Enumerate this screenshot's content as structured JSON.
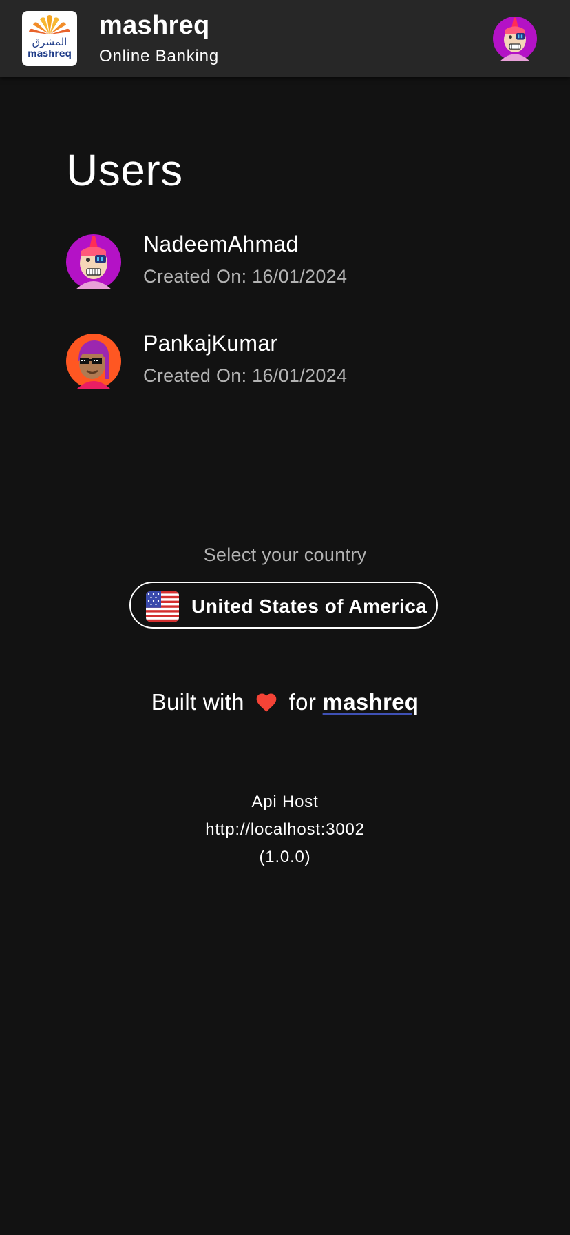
{
  "header": {
    "title": "mashreq",
    "subtitle": "Online Banking",
    "logo_arabic": "المشرق",
    "logo_latin": "mashreq",
    "logo_icon": "mashreq-sun-logo-icon",
    "avatar_icon": "user-avatar-icon"
  },
  "users": {
    "title": "Users",
    "items": [
      {
        "name": "NadeemAhmad",
        "created": "Created On: 16/01/2024",
        "avatar": "avatar-mohawk-icon"
      },
      {
        "name": "PankajKumar",
        "created": "Created On: 16/01/2024",
        "avatar": "avatar-sunglasses-icon"
      }
    ]
  },
  "country": {
    "label": "Select your country",
    "selected": "United States of America",
    "flag_icon": "us-flag-icon"
  },
  "footer": {
    "built_prefix": "Built with",
    "built_middle": "for",
    "brand": "mashreq",
    "heart_icon": "heart-icon",
    "api_label": "Api Host",
    "api_host": "http://localhost:3002",
    "version": "(1.0.0)"
  },
  "colors": {
    "background": "#121212",
    "appbar": "#272727",
    "heart": "#f44336",
    "secondary_text": "#b3b3b3",
    "link_underline": "#3f51b5"
  }
}
